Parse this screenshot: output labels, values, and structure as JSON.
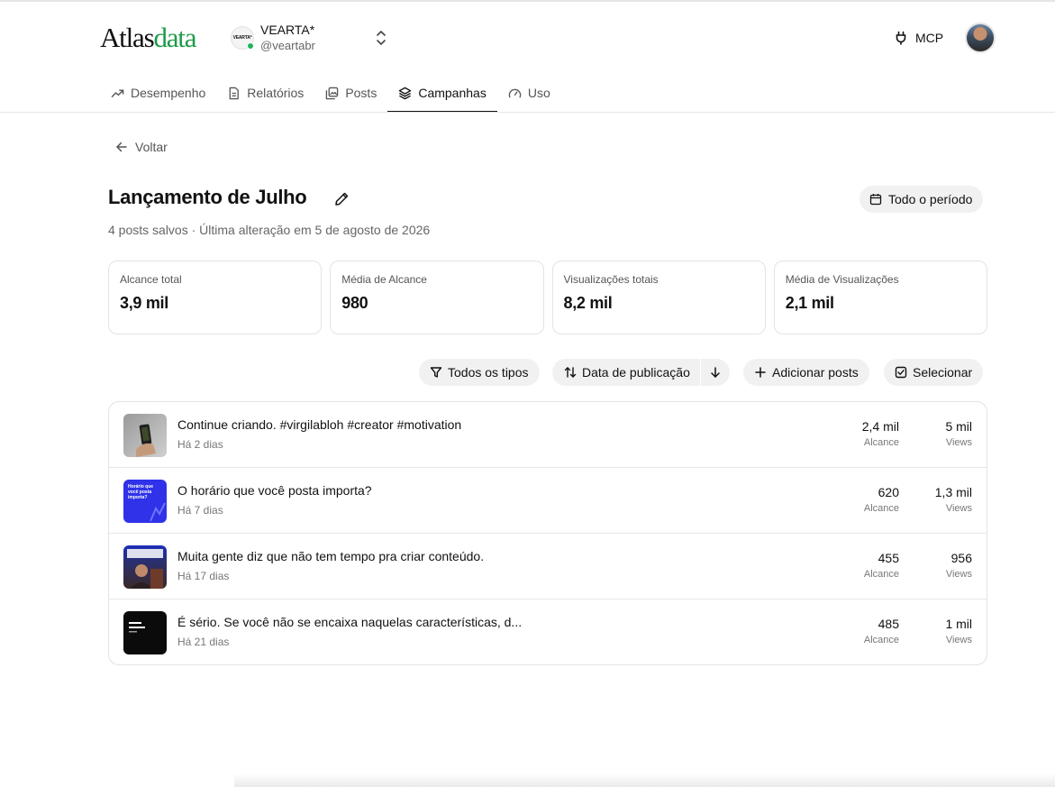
{
  "brand": {
    "part1": "Atlas",
    "part2": "data"
  },
  "account": {
    "avatar_text": "VEARTA*",
    "name": "VEARTA*",
    "handle": "@veartabr"
  },
  "header": {
    "mcp_label": "MCP"
  },
  "tabs": [
    {
      "label": "Desempenho",
      "icon": "trending-up-icon"
    },
    {
      "label": "Relatórios",
      "icon": "document-icon"
    },
    {
      "label": "Posts",
      "icon": "images-icon"
    },
    {
      "label": "Campanhas",
      "icon": "layers-icon",
      "active": true
    },
    {
      "label": "Uso",
      "icon": "gauge-icon"
    }
  ],
  "back_label": "Voltar",
  "campaign": {
    "title": "Lançamento de Julho",
    "subtitle": "4 posts salvos · Última alteração em 5 de agosto de 2026",
    "period_label": "Todo o período"
  },
  "stats": [
    {
      "label": "Alcance total",
      "value": "3,9 mil"
    },
    {
      "label": "Média de Alcance",
      "value": "980"
    },
    {
      "label": "Visualizações totais",
      "value": "8,2 mil"
    },
    {
      "label": "Média de Visualizações",
      "value": "2,1 mil"
    }
  ],
  "toolbar": {
    "filter_label": "Todos os tipos",
    "sort_label": "Data de publicação",
    "add_label": "Adicionar posts",
    "select_label": "Selecionar"
  },
  "metric_labels": {
    "reach": "Alcance",
    "views": "Views"
  },
  "posts": [
    {
      "caption": "Continue criando. #virgilabloh #creator #motivation",
      "age": "Há 2 dias",
      "reach": "2,4 mil",
      "views": "5 mil",
      "thumb_text": ""
    },
    {
      "caption": "O horário que você posta importa?",
      "age": "Há 7 dias",
      "reach": "620",
      "views": "1,3 mil",
      "thumb_text": "Horário que você posta importa?"
    },
    {
      "caption": "Muita gente diz que não tem tempo pra criar conteúdo.",
      "age": "Há 17 dias",
      "reach": "455",
      "views": "956",
      "thumb_text": ""
    },
    {
      "caption": "É sério. Se você não se encaixa naquelas características, d...",
      "age": "Há 21 dias",
      "reach": "485",
      "views": "1 mil",
      "thumb_text": ""
    }
  ],
  "colors": {
    "brand_green": "#1f9a4a",
    "online_green": "#21b35b",
    "pill_bg": "#f1f1f1"
  }
}
